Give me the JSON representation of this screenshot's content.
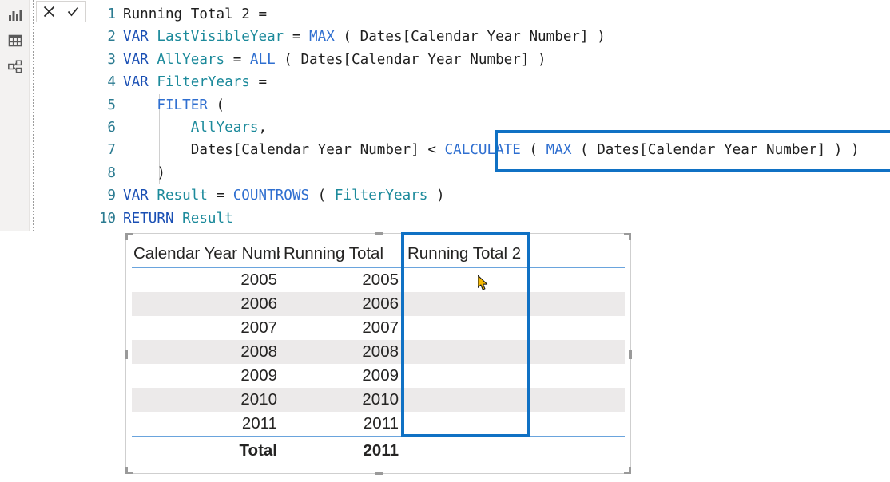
{
  "app": {
    "name": "Power BI Desktop DAX formula editor"
  },
  "nav_rail": {
    "items": [
      {
        "name": "report-view",
        "icon": "bar-chart-icon",
        "label": "Report"
      },
      {
        "name": "data-view",
        "icon": "table-icon",
        "label": "Data"
      },
      {
        "name": "model-view",
        "icon": "relationships-icon",
        "label": "Model"
      }
    ]
  },
  "formula_toolbar": {
    "cancel_label": "✕",
    "commit_label": "✓",
    "cancel_name": "cancel-formula",
    "commit_name": "commit-formula"
  },
  "editor": {
    "measure_name": "Running Total 2",
    "lines": [
      {
        "number": "1",
        "tokens": [
          {
            "t": "Running Total 2 =",
            "c": "tbl"
          }
        ]
      },
      {
        "number": "2",
        "tokens": [
          {
            "t": "VAR ",
            "c": "kw"
          },
          {
            "t": "LastVisibleYear",
            "c": "var"
          },
          {
            "t": " = ",
            "c": "pun"
          },
          {
            "t": "MAX",
            "c": "fn"
          },
          {
            "t": " ( Dates[Calendar Year Number] )",
            "c": "tbl"
          }
        ]
      },
      {
        "number": "3",
        "tokens": [
          {
            "t": "VAR ",
            "c": "kw"
          },
          {
            "t": "AllYears",
            "c": "var"
          },
          {
            "t": " = ",
            "c": "pun"
          },
          {
            "t": "ALL",
            "c": "fn"
          },
          {
            "t": " ( Dates[Calendar Year Number] )",
            "c": "tbl"
          }
        ]
      },
      {
        "number": "4",
        "tokens": [
          {
            "t": "VAR ",
            "c": "kw"
          },
          {
            "t": "FilterYears",
            "c": "var"
          },
          {
            "t": " =",
            "c": "pun"
          }
        ]
      },
      {
        "number": "5",
        "tokens": [
          {
            "t": "    ",
            "c": "pun"
          },
          {
            "t": "FILTER",
            "c": "fn"
          },
          {
            "t": " (",
            "c": "pun"
          }
        ]
      },
      {
        "number": "6",
        "tokens": [
          {
            "t": "        ",
            "c": "pun"
          },
          {
            "t": "AllYears",
            "c": "var"
          },
          {
            "t": ",",
            "c": "pun"
          }
        ]
      },
      {
        "number": "7",
        "tokens": [
          {
            "t": "        Dates[Calendar Year Number]",
            "c": "tbl"
          },
          {
            "t": " < ",
            "c": "pun"
          },
          {
            "t": "CALCULATE",
            "c": "fn"
          },
          {
            "t": " ( ",
            "c": "pun"
          },
          {
            "t": "MAX",
            "c": "fn"
          },
          {
            "t": " ( Dates[Calendar Year Number] ) )",
            "c": "tbl"
          }
        ]
      },
      {
        "number": "8",
        "tokens": [
          {
            "t": "    )",
            "c": "pun"
          }
        ]
      },
      {
        "number": "9",
        "tokens": [
          {
            "t": "VAR ",
            "c": "kw"
          },
          {
            "t": "Result",
            "c": "var"
          },
          {
            "t": " = ",
            "c": "pun"
          },
          {
            "t": "COUNTROWS",
            "c": "fn"
          },
          {
            "t": " ( ",
            "c": "pun"
          },
          {
            "t": "FilterYears",
            "c": "var"
          },
          {
            "t": " )",
            "c": "pun"
          }
        ]
      },
      {
        "number": "10",
        "tokens": [
          {
            "t": "RETURN ",
            "c": "kw"
          },
          {
            "t": "Result",
            "c": "var"
          }
        ]
      }
    ],
    "highlight": {
      "name": "calculate-expression-highlight",
      "text": "< CALCULATE ( MAX ( Dates[Calendar Year Number] ) )",
      "color": "#1071c4"
    }
  },
  "table_visual": {
    "columns": [
      "Calendar Year Number",
      "Running Total",
      "Running Total 2"
    ],
    "rows": [
      {
        "year": "2005",
        "running_total": "2005",
        "running_total_2": ""
      },
      {
        "year": "2006",
        "running_total": "2006",
        "running_total_2": ""
      },
      {
        "year": "2007",
        "running_total": "2007",
        "running_total_2": ""
      },
      {
        "year": "2008",
        "running_total": "2008",
        "running_total_2": ""
      },
      {
        "year": "2009",
        "running_total": "2009",
        "running_total_2": ""
      },
      {
        "year": "2010",
        "running_total": "2010",
        "running_total_2": ""
      },
      {
        "year": "2011",
        "running_total": "2011",
        "running_total_2": ""
      }
    ],
    "total_row": {
      "label": "Total",
      "running_total": "2011",
      "running_total_2": ""
    },
    "hovered_row_index": 0,
    "column_highlight": {
      "name": "running-total-2-column-highlight",
      "color": "#1071c4"
    },
    "accent_line_color": "#6aa4dd",
    "alt_row_color": "#eceaea",
    "hover_cell_color": "#c8c6c4"
  }
}
